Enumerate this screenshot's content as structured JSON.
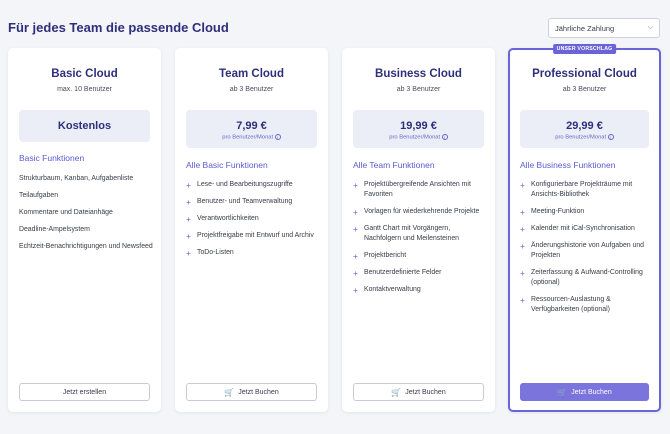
{
  "header": {
    "title": "Für jedes Team die passende Cloud",
    "billing_select": "Jährliche Zahlung"
  },
  "plans": [
    {
      "title": "Basic Cloud",
      "subtitle": "max. 10 Benutzer",
      "price": "Kostenlos",
      "section_title": "Basic Funktionen",
      "features": [
        "Strukturbaum, Kanban, Aufgabenliste",
        "Teilaufgaben",
        "Kommentare und Dateianhäge",
        "Deadline-Ampelsystem",
        "Echtzeit-Benachrichtigungen und Newsfeed"
      ],
      "button": "Jetzt erstellen"
    },
    {
      "title": "Team Cloud",
      "subtitle": "ab 3 Benutzer",
      "price": "7,99 €",
      "price_unit": "pro Benutzer/Monat",
      "section_title": "Alle Basic Funktionen",
      "features": [
        "Lese- und Bearbeitungszugriffe",
        "Benutzer- und Teamverwaltung",
        "Verantwortlichkeiten",
        "Projektfreigabe mit Entwurf und Archiv",
        "ToDo-Listen"
      ],
      "button": "Jetzt Buchen"
    },
    {
      "title": "Business Cloud",
      "subtitle": "ab 3 Benutzer",
      "price": "19,99 €",
      "price_unit": "pro Benutzer/Monat",
      "section_title": "Alle Team Funktionen",
      "features": [
        "Projektübergreifende Ansichten mit Favoriten",
        "Vorlagen für wiederkehrende Projekte",
        "Gantt Chart mit Vorgängern, Nachfolgern und Meilensteinen",
        "Projektbericht",
        "Benutzerdefinierte Felder",
        "Kontaktverwaltung"
      ],
      "button": "Jetzt Buchen"
    },
    {
      "badge": "UNSER VORSCHLAG",
      "title": "Professional Cloud",
      "subtitle": "ab 3 Benutzer",
      "price": "29,99 €",
      "price_unit": "pro Benutzer/Monat",
      "section_title": "Alle Business Funktionen",
      "features": [
        "Konfigurierbare Projekträume mit Ansichts-Bibliothek",
        "Meeting-Funktion",
        "Kalender mit iCal-Synchronisation",
        "Änderungshistorie von Aufgaben und Projekten",
        "Zeiterfassung & Aufwand-Controlling (optional)",
        "Ressourcen-Auslastung & Verfügbarkeiten (optional)"
      ],
      "button": "Jetzt Buchen"
    }
  ],
  "colors": {
    "accent": "#6a64d8",
    "title": "#2e2f7a",
    "background": "#f4f5f9"
  }
}
